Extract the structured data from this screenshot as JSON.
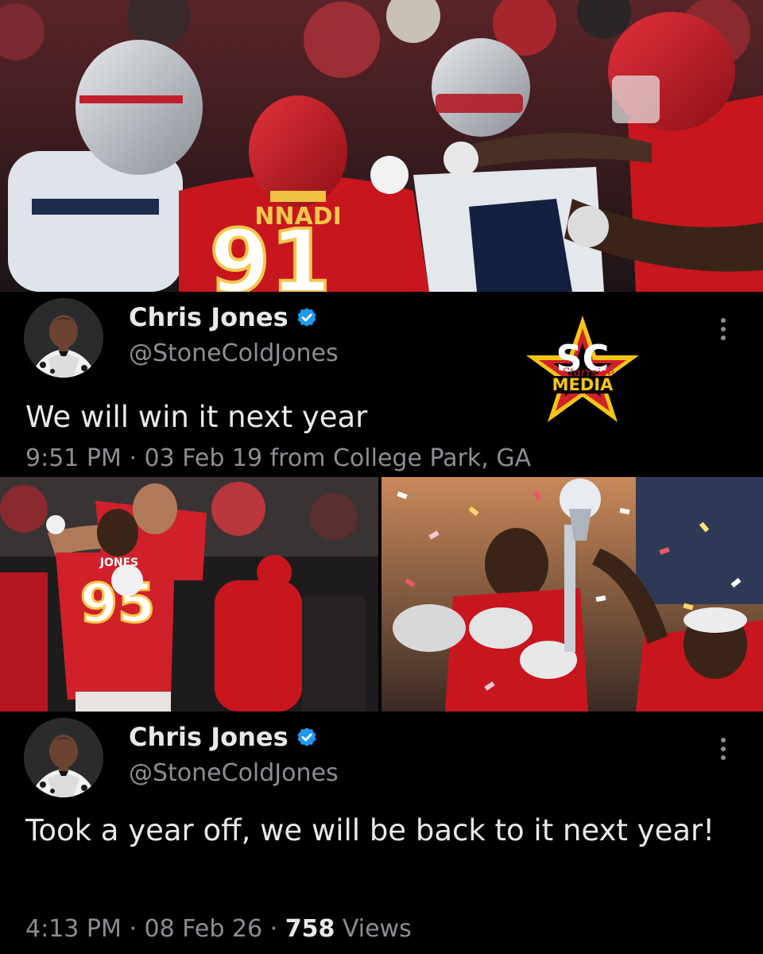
{
  "tweets": [
    {
      "display_name": "Chris Jones",
      "handle": "@StoneColdJones",
      "text": "We will win it next year",
      "time": "9:51 PM",
      "separator": "·",
      "date": "03 Feb 19",
      "source": "from College Park, GA"
    },
    {
      "display_name": "Chris Jones",
      "handle": "@StoneColdJones",
      "text": "Took a year off, we will be back to it next year!",
      "time": "4:13 PM",
      "separator": "·",
      "date": "08 Feb 26",
      "views_count": "758",
      "views_label": "Views"
    }
  ],
  "photos": {
    "top_jersey_name": "NNADI",
    "top_jersey_number": "91",
    "left_jersey_name": "JONES",
    "left_jersey_number": "95"
  },
  "logo": {
    "letters": "SC",
    "script": "Starrside",
    "word": "MEDIA"
  },
  "icons": {
    "verified": "verified-badge-icon",
    "more": "more-options-icon"
  },
  "colors": {
    "background": "#000000",
    "text_primary": "#e7e9ea",
    "text_secondary": "#8b8f94",
    "verified_blue": "#1d9bf0",
    "chiefs_red": "#d0212b",
    "gold": "#f5c518"
  }
}
